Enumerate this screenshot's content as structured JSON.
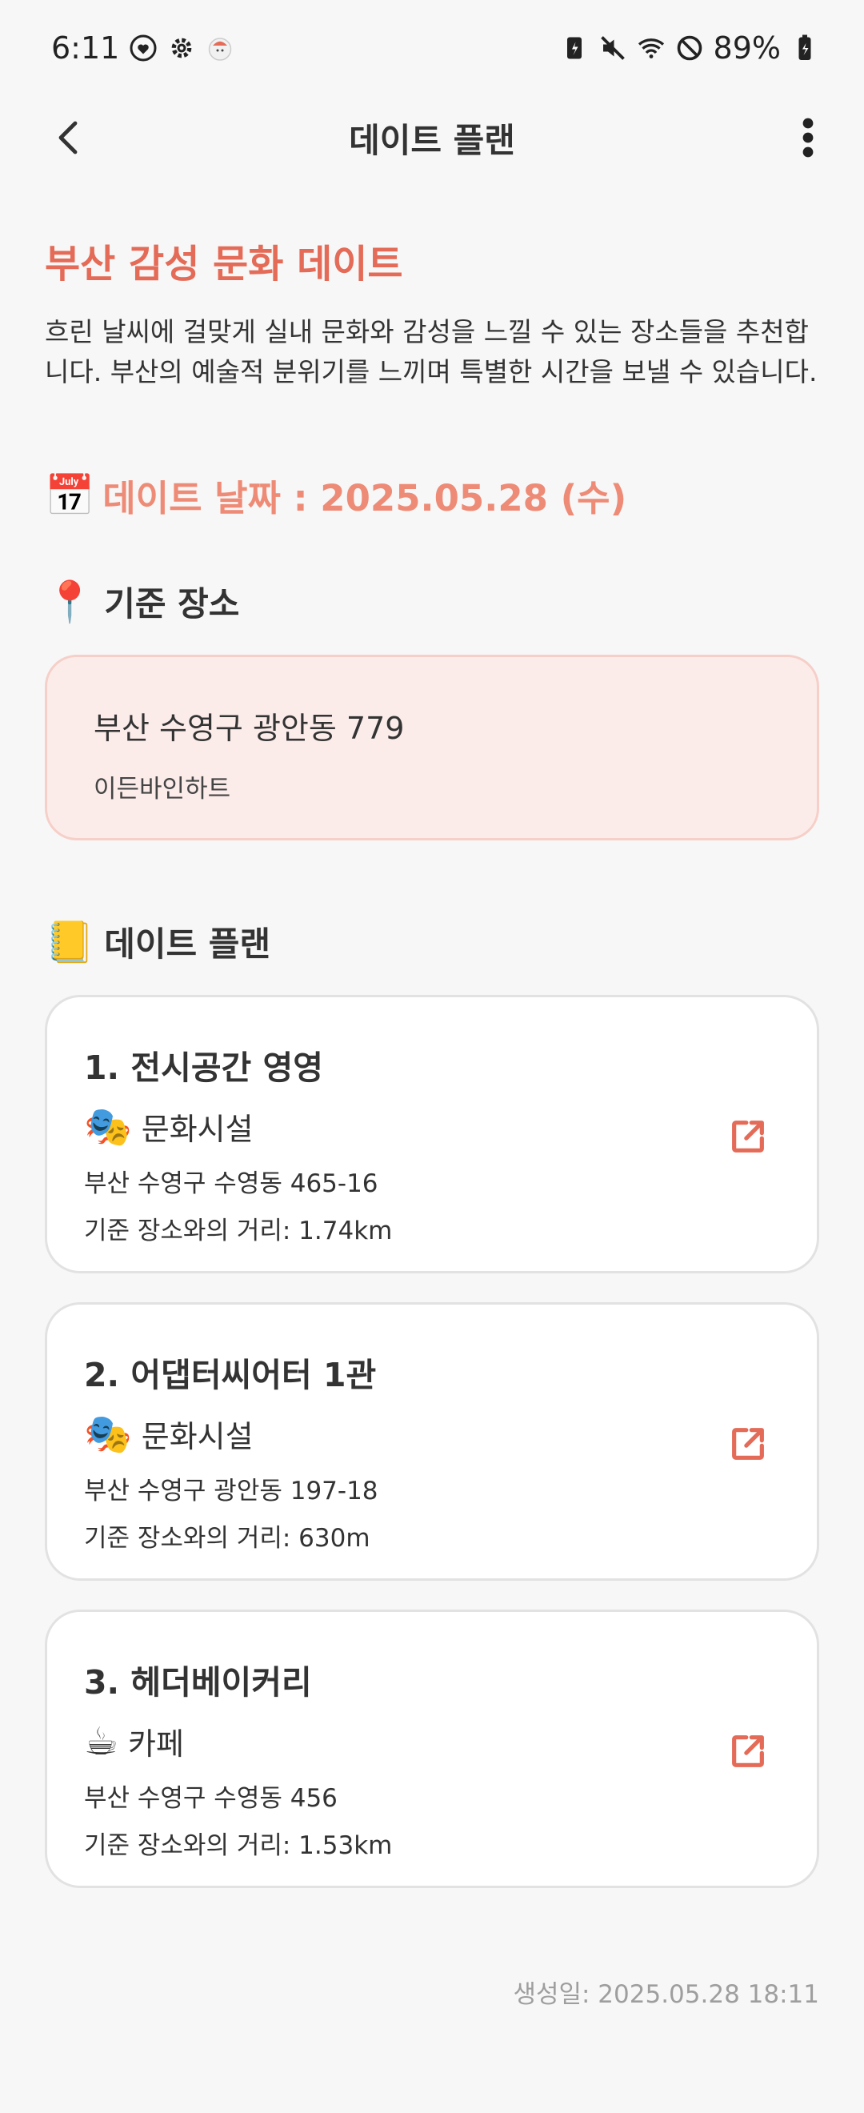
{
  "status_bar": {
    "time": "6:11",
    "battery": "89%"
  },
  "app_bar": {
    "title": "데이트 플랜"
  },
  "plan": {
    "title": "부산 감성 문화 데이트",
    "description": "흐린 날씨에 걸맞게 실내 문화와 감성을 느낄 수 있는 장소들을 추천합니다. 부산의 예술적 분위기를 느끼며 특별한 시간을 보낼 수 있습니다.",
    "date_emoji": "📅",
    "date_label": "데이트 날짜 :  2025.05.28 (수)"
  },
  "base_location": {
    "emoji": "📍",
    "heading": "기준 장소",
    "address": "부산 수영구 광안동 779",
    "name": "이든바인하트"
  },
  "plan_list": {
    "emoji": "📒",
    "heading": "데이트 플랜",
    "items": [
      {
        "name": "1. 전시공간 영영",
        "category_emoji": "🎭",
        "category": "문화시설",
        "address": "부산 수영구 수영동 465-16",
        "distance": "기준 장소와의 거리: 1.74km"
      },
      {
        "name": "2. 어댑터씨어터 1관",
        "category_emoji": "🎭",
        "category": "문화시설",
        "address": "부산 수영구 광안동 197-18",
        "distance": "기준 장소와의 거리: 630m"
      },
      {
        "name": "3. 헤더베이커리",
        "category_emoji": "☕",
        "category": "카페",
        "address": "부산 수영구 수영동 456",
        "distance": "기준 장소와의 거리: 1.53km"
      }
    ]
  },
  "footer": {
    "created": "생성일: 2025.05.28 18:11"
  },
  "colors": {
    "accent": "#e46b57",
    "date_accent": "#ee8b76",
    "base_card_bg": "#fbecea",
    "base_card_border": "#f6cfc8"
  }
}
